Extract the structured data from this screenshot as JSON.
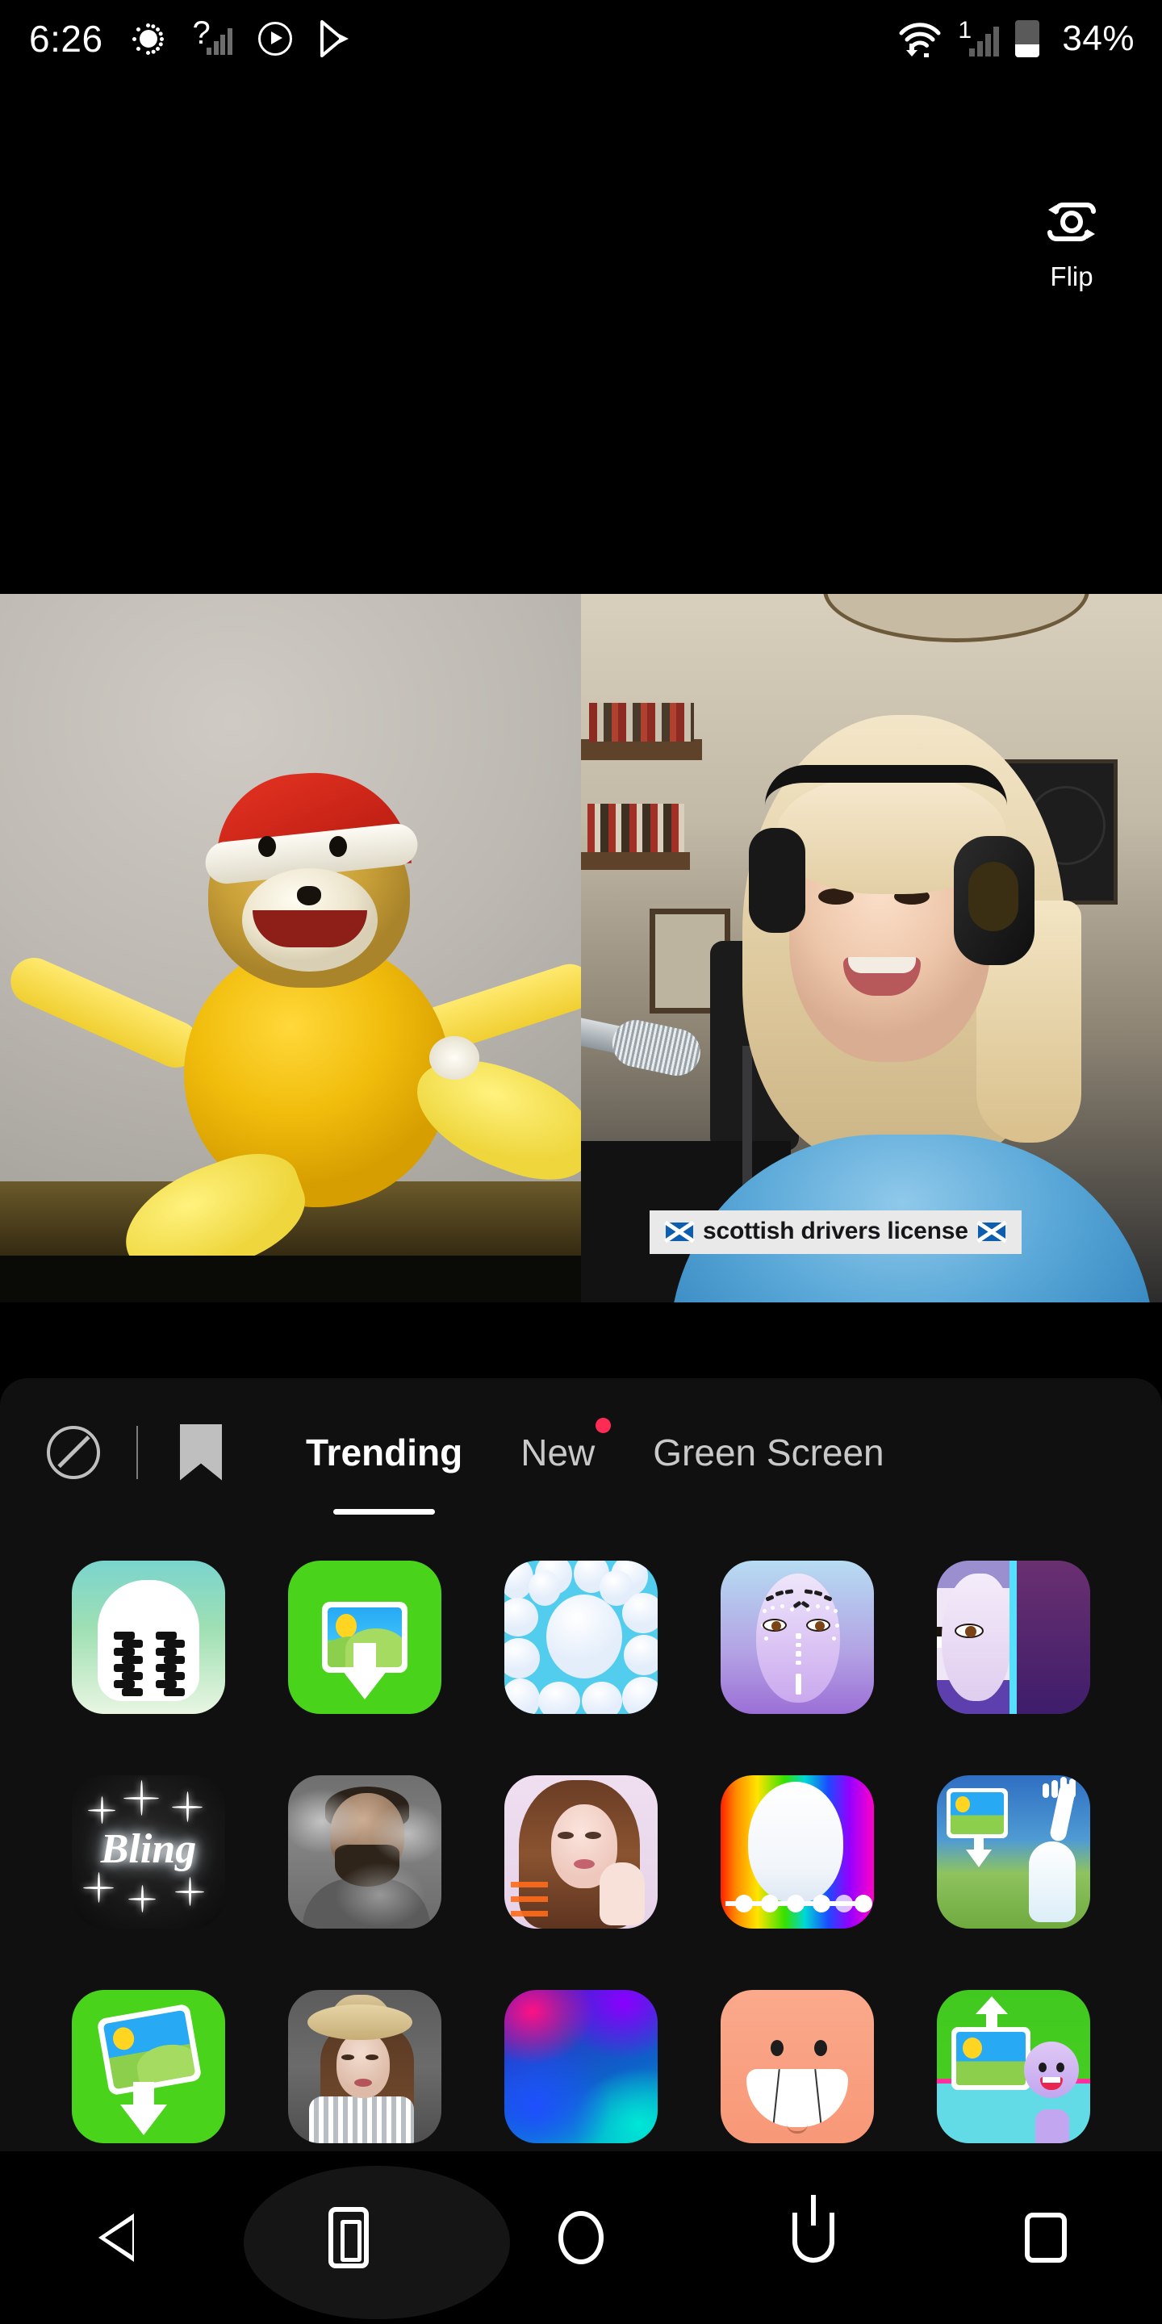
{
  "status_bar": {
    "time": "6:26",
    "battery_percent": "34%",
    "icons": [
      "brightness-icon",
      "question-signal-icon",
      "play-circle-icon",
      "play-store-icon",
      "wifi-icon",
      "cellular-signal-icon",
      "battery-icon"
    ]
  },
  "camera": {
    "flip_label": "Flip",
    "flip_icon": "camera-flip-icon",
    "caption": "scottish drivers license",
    "caption_flag_left": "scotland-flag-icon",
    "caption_flag_right": "scotland-flag-icon"
  },
  "effects_panel": {
    "tools": [
      {
        "name": "no-effect-icon",
        "label": "No effect"
      },
      {
        "name": "bookmark-icon",
        "label": "Favorites"
      }
    ],
    "tabs": [
      {
        "label": "Trending",
        "active": true,
        "badge": false
      },
      {
        "label": "New",
        "active": false,
        "badge": true
      },
      {
        "label": "Green Screen",
        "active": false,
        "badge": false
      }
    ],
    "rows": [
      [
        {
          "name": "wobble-jelly-effect"
        },
        {
          "name": "green-photo-download-effect"
        },
        {
          "name": "bubbles-effect"
        },
        {
          "name": "tribal-face-paint-effect"
        },
        {
          "name": "split-face-effect"
        }
      ],
      [
        {
          "name": "bling-effect",
          "label": "Bling"
        },
        {
          "name": "smoky-man-effect"
        },
        {
          "name": "glam-portrait-effect"
        },
        {
          "name": "rainbow-color-picker-effect"
        },
        {
          "name": "green-screen-hand-effect"
        }
      ],
      [
        {
          "name": "green-photo-tilt-effect"
        },
        {
          "name": "hat-portrait-effect"
        },
        {
          "name": "neon-gradient-effect"
        },
        {
          "name": "big-smile-effect"
        },
        {
          "name": "green-screen-sticker-effect"
        }
      ]
    ]
  },
  "nav_bar": {
    "items": [
      {
        "name": "back-button"
      },
      {
        "name": "screenshot-button"
      },
      {
        "name": "home-button"
      },
      {
        "name": "power-button"
      },
      {
        "name": "recent-apps-button"
      }
    ]
  },
  "colors": {
    "accent_red": "#fe2c55",
    "panel_bg": "#141414",
    "active_tab": "#ffffff",
    "inactive_tab": "#c9c9c9"
  }
}
